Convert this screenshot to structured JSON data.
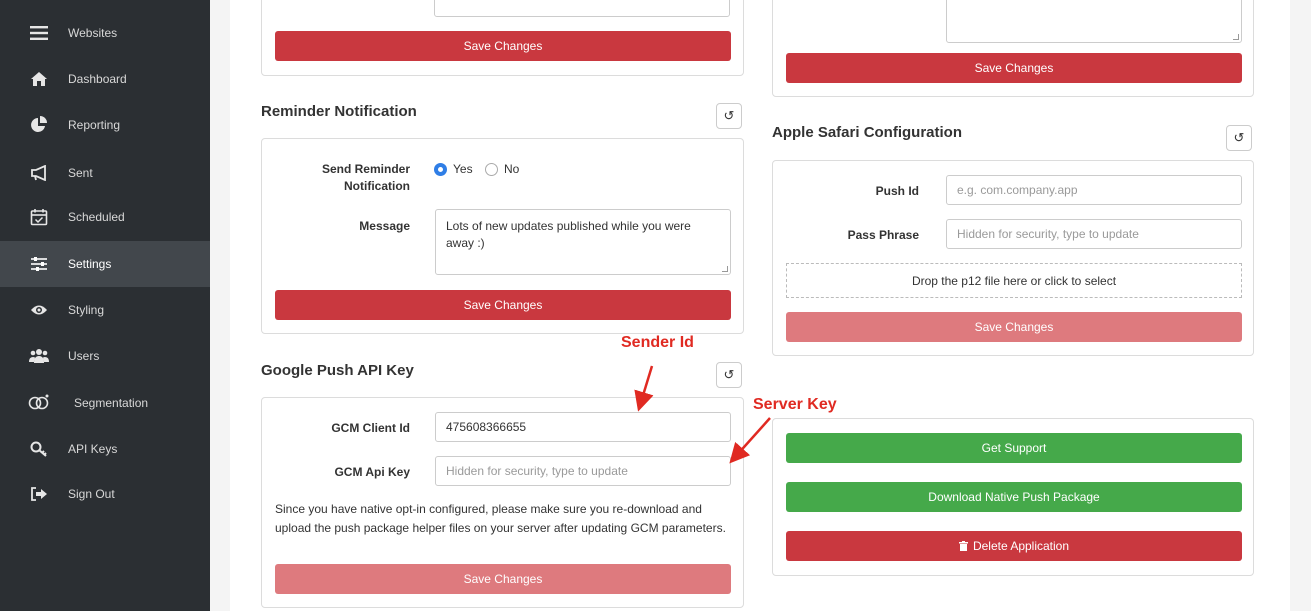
{
  "sidebar": {
    "items": [
      {
        "label": "Websites",
        "icon": "hamburger-icon"
      },
      {
        "label": "Dashboard",
        "icon": "home-icon"
      },
      {
        "label": "Reporting",
        "icon": "pie-chart-icon"
      },
      {
        "label": "Sent",
        "icon": "megaphone-icon"
      },
      {
        "label": "Scheduled",
        "icon": "calendar-icon"
      },
      {
        "label": "Settings",
        "icon": "sliders-icon"
      },
      {
        "label": "Styling",
        "icon": "eye-icon"
      },
      {
        "label": "Users",
        "icon": "users-icon"
      },
      {
        "label": "Segmentation",
        "icon": "venn-icon"
      },
      {
        "label": "API Keys",
        "icon": "key-icon"
      },
      {
        "label": "Sign Out",
        "icon": "sign-out-icon"
      }
    ]
  },
  "top_left_card": {
    "save_label": "Save Changes"
  },
  "top_right_card": {
    "save_label": "Save Changes"
  },
  "reminder": {
    "title": "Reminder Notification",
    "send_label": "Send Reminder Notification",
    "send_label_line1": "Send Reminder",
    "send_label_line2": "Notification",
    "yes_label": "Yes",
    "no_label": "No",
    "selected": "Yes",
    "message_label": "Message",
    "message_value": "Lots of new updates published while you were away :)",
    "save_label": "Save Changes"
  },
  "safari": {
    "title": "Apple Safari Configuration",
    "push_id_label": "Push Id",
    "push_id_placeholder": "e.g. com.company.app",
    "pass_label": "Pass Phrase",
    "pass_placeholder": "Hidden for security, type to update",
    "dropzone_text": "Drop the p12 file here or click to select",
    "save_label": "Save Changes"
  },
  "google": {
    "title": "Google Push API Key",
    "client_id_label": "GCM Client Id",
    "client_id_value": "475608366655",
    "api_key_label": "GCM Api Key",
    "api_key_placeholder": "Hidden for security, type to update",
    "note": "Since you have native opt-in configured, please make sure you re-download and upload the push package helper files on your server after updating GCM parameters.",
    "save_label": "Save Changes"
  },
  "actions": {
    "support_label": "Get Support",
    "download_label": "Download Native Push Package",
    "delete_label": "Delete Application"
  },
  "annotations": {
    "sender_id": "Sender Id",
    "server_key": "Server Key"
  },
  "colors": {
    "sidebar_bg": "#2b2f33",
    "danger": "#c9383f",
    "danger_disabled": "#de7a7e",
    "success": "#45a94a",
    "radio_accent": "#2f7ee6",
    "annotation": "#e02a22"
  }
}
